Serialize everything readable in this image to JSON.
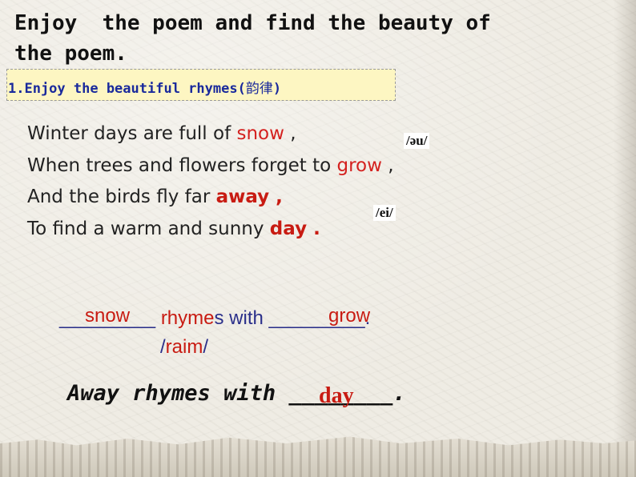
{
  "title": "Enjoy  the poem and find the beauty of the poem.",
  "section": {
    "label_prefix": "1.Enjoy the beautiful rhymes(",
    "label_chinese": "韵律",
    "label_suffix": ")"
  },
  "poem": {
    "lines": [
      {
        "before": "Winter days are full of ",
        "rhyme": "snow",
        "after": " ,"
      },
      {
        "before": "When trees and flowers forget to ",
        "rhyme": "grow",
        "after": " ,"
      },
      {
        "before": "And the birds fly far ",
        "rhyme": "away ,",
        "after": ""
      },
      {
        "before": "To find a warm and sunny ",
        "rhyme": "day .",
        "after": ""
      }
    ],
    "phonetics": [
      "/əu/",
      "/ei/"
    ]
  },
  "exercise1": {
    "blank1": "_________",
    "answer1": "snow",
    "rhyme_word": "rhyme",
    "middle": "s with ",
    "blank2": "_________.",
    "answer2": "grow",
    "ipa_open": "/",
    "ipa_text": "raim",
    "ipa_close": "/"
  },
  "exercise2": {
    "text": "Away rhymes with ________.",
    "answer": "day"
  }
}
